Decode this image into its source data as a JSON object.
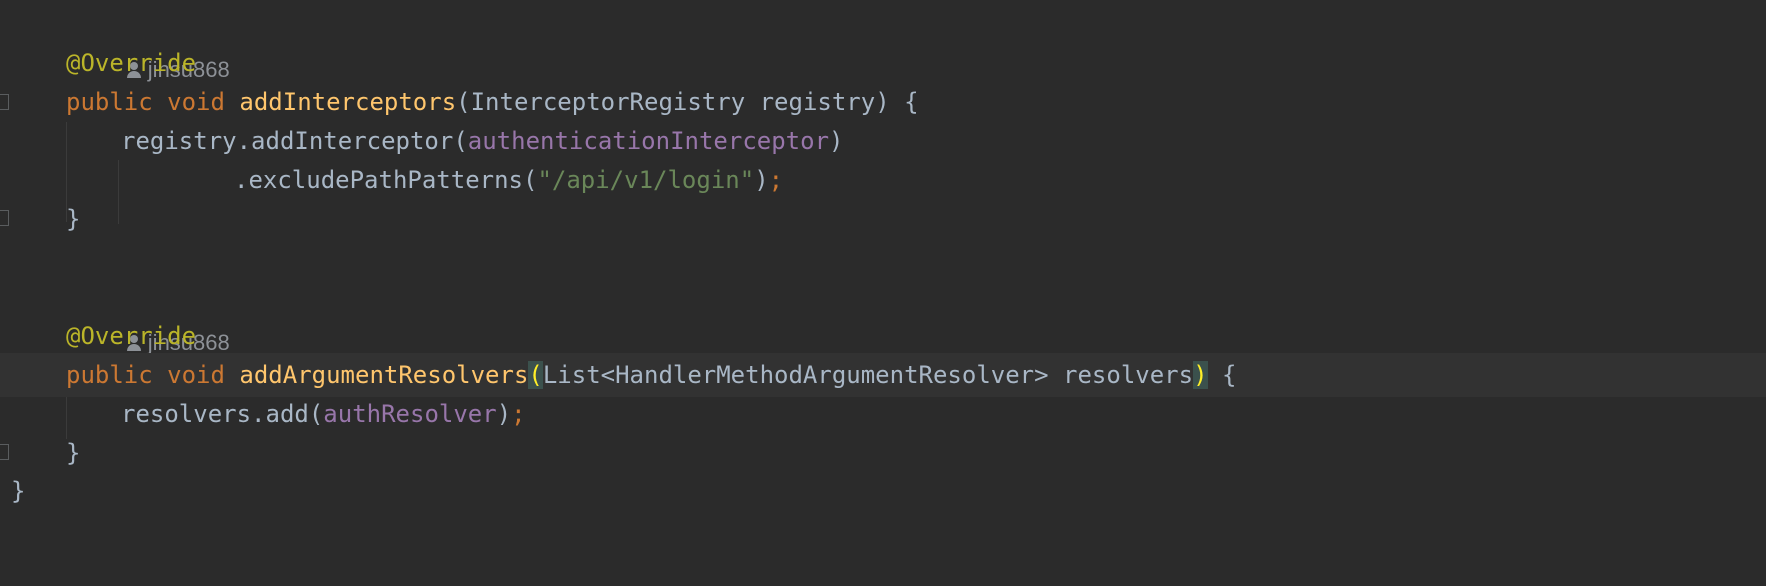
{
  "block1": {
    "author": "jinsu868",
    "annotation": "@Override",
    "kw_public": "public",
    "kw_void": "void",
    "method_name": "addInterceptors",
    "open_paren": "(",
    "params": "InterceptorRegistry registry",
    "close_paren_brace": ") {",
    "body_line1_prefix": "registry.addInterceptor(",
    "body_line1_field": "authenticationInterceptor",
    "body_line1_suffix": ")",
    "body_line2_prefix": ".excludePathPatterns(",
    "body_line2_string": "\"/api/v1/login\"",
    "body_line2_close": ")",
    "semicolon": ";",
    "close_brace": "}"
  },
  "block2": {
    "author": "jinsu868",
    "annotation": "@Override",
    "kw_public": "public",
    "kw_void": "void",
    "method_name": "addArgumentResolvers",
    "open_paren": "(",
    "params": "List<HandlerMethodArgumentResolver> resolvers",
    "close_paren": ")",
    "open_brace": " {",
    "body_prefix": "resolvers.add(",
    "body_field": "authResolver",
    "body_close": ")",
    "semicolon": ";",
    "close_brace": "}"
  },
  "class_close_brace": "}",
  "colors": {
    "background": "#2b2b2b",
    "current_line": "#323232",
    "annotation": "#bbb529",
    "keyword": "#cc7832",
    "method_declaration": "#ffc66d",
    "field": "#9876aa",
    "string": "#6a8759",
    "text": "#a9b7c6",
    "brace_match_bg": "#3b514d",
    "brace_match_fg": "#ffef28"
  }
}
